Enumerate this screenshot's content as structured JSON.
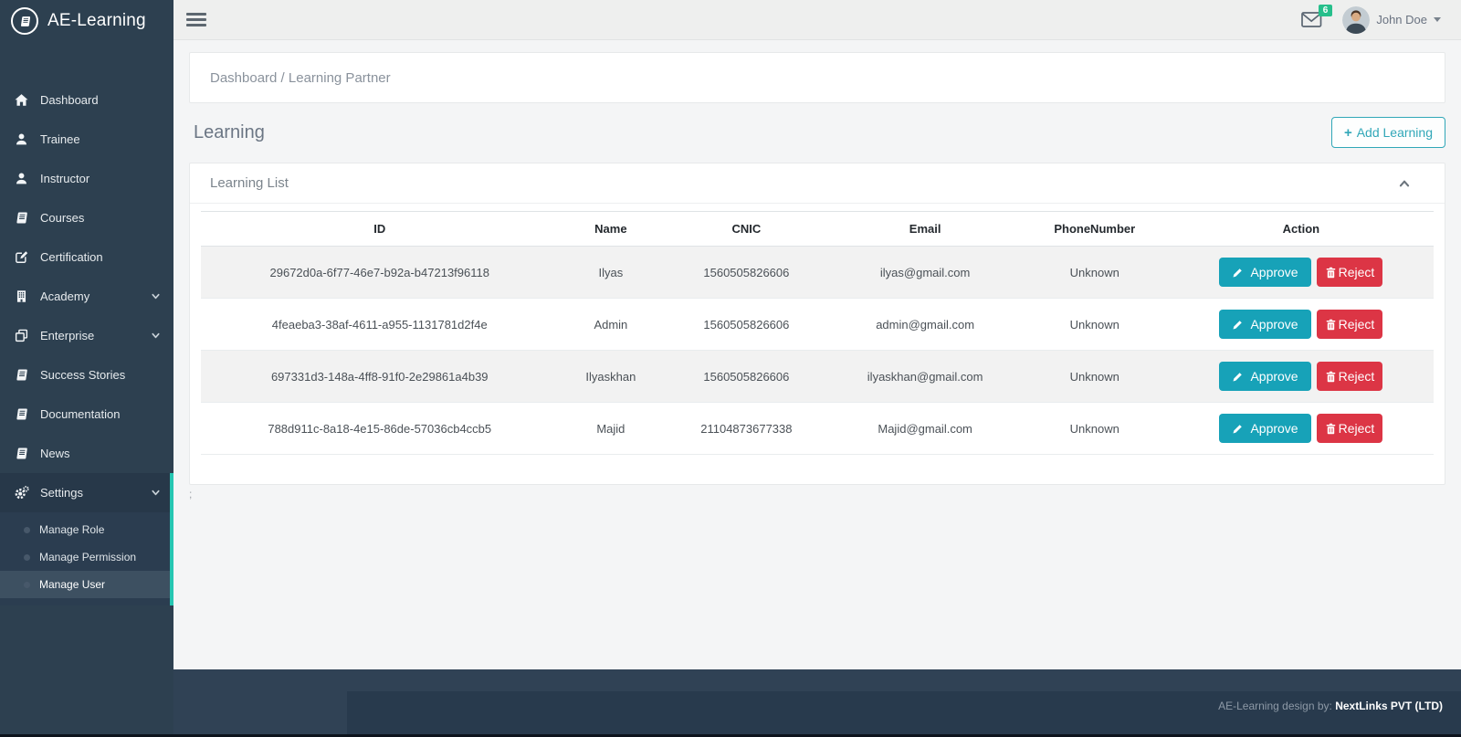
{
  "app": {
    "title": "AE-Learning"
  },
  "sidebar": {
    "items": [
      {
        "label": "Dashboard",
        "icon": "home"
      },
      {
        "label": "Trainee",
        "icon": "user"
      },
      {
        "label": "Instructor",
        "icon": "user"
      },
      {
        "label": "Courses",
        "icon": "book"
      },
      {
        "label": "Certification",
        "icon": "edit"
      },
      {
        "label": "Academy",
        "icon": "building",
        "expandable": true
      },
      {
        "label": "Enterprise",
        "icon": "copy",
        "expandable": true
      },
      {
        "label": "Success Stories",
        "icon": "book"
      },
      {
        "label": "Documentation",
        "icon": "book"
      },
      {
        "label": "News",
        "icon": "book"
      },
      {
        "label": "Settings",
        "icon": "cogs",
        "expandable": true,
        "expanded": true
      }
    ],
    "settings_submenu": [
      {
        "label": "Manage Role"
      },
      {
        "label": "Manage Permission"
      },
      {
        "label": "Manage User",
        "active": true
      }
    ]
  },
  "topbar": {
    "mail_badge": "6",
    "user_name": "John Doe"
  },
  "breadcrumb": {
    "text": "Dashboard / Learning Partner"
  },
  "page": {
    "title": "Learning",
    "add_icon": "+",
    "add_button_label": "Add Learning"
  },
  "card": {
    "title": "Learning List"
  },
  "table": {
    "headers": [
      "ID",
      "Name",
      "CNIC",
      "Email",
      "PhoneNumber",
      "Action"
    ],
    "approve_label": "Approve",
    "reject_label": "Reject",
    "rows": [
      {
        "id": "29672d0a-6f77-46e7-b92a-b47213f96118",
        "name": "Ilyas",
        "cnic": "1560505826606",
        "email": "ilyas@gmail.com",
        "phone": "Unknown"
      },
      {
        "id": "4feaeba3-38af-4611-a955-1131781d2f4e",
        "name": "Admin",
        "cnic": "1560505826606",
        "email": "admin@gmail.com",
        "phone": "Unknown"
      },
      {
        "id": "697331d3-148a-4ff8-91f0-2e29861a4b39",
        "name": "Ilyaskhan",
        "cnic": "1560505826606",
        "email": "ilyaskhan@gmail.com",
        "phone": "Unknown"
      },
      {
        "id": "788d911c-8a18-4e15-86de-57036cb4ccb5",
        "name": "Majid",
        "cnic": "21104873677338",
        "email": "Majid@gmail.com",
        "phone": "Unknown"
      }
    ]
  },
  "stray_text": ";",
  "footer": {
    "prefix": "AE-Learning design by: ",
    "company": "NextLinks PVT (LTD)"
  },
  "colors": {
    "accent_teal": "#26c6b2",
    "approve": "#17a2b8",
    "reject": "#dc3545",
    "badge_green": "#26bf8b",
    "sidebar_bg": "#2d4050"
  }
}
